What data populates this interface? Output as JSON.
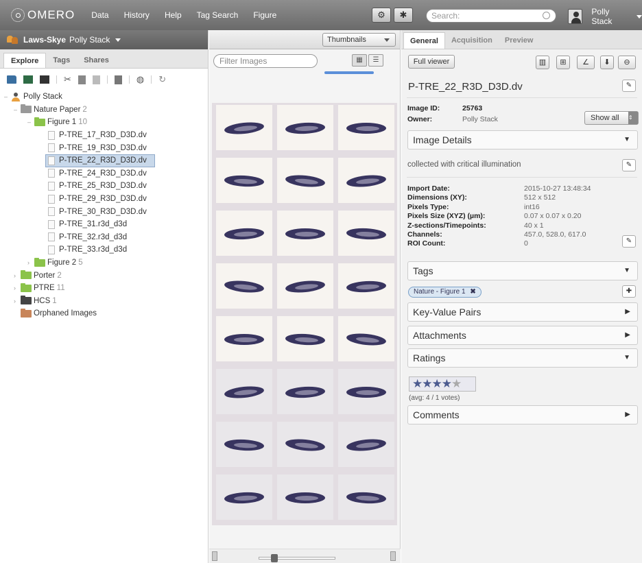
{
  "topbar": {
    "logo": "OMERO",
    "nav": [
      "Data",
      "History",
      "Help",
      "Tag Search",
      "Figure"
    ],
    "search_placeholder": "Search:",
    "user": "Polly Stack"
  },
  "left": {
    "group": {
      "name": "Laws-Skye",
      "owner": "Polly Stack"
    },
    "tabs": [
      "Explore",
      "Tags",
      "Shares"
    ],
    "tree": {
      "root": "Polly Stack",
      "project": {
        "name": "Nature Paper",
        "count": "2"
      },
      "dataset_open": {
        "name": "Figure 1",
        "count": "10"
      },
      "images": [
        "P-TRE_17_R3D_D3D.dv",
        "P-TRE_19_R3D_D3D.dv",
        "P-TRE_22_R3D_D3D.dv",
        "P-TRE_24_R3D_D3D.dv",
        "P-TRE_25_R3D_D3D.dv",
        "P-TRE_29_R3D_D3D.dv",
        "P-TRE_30_R3D_D3D.dv",
        "P-TRE_31.r3d_d3d",
        "P-TRE_32.r3d_d3d",
        "P-TRE_33.r3d_d3d"
      ],
      "dataset_closed": {
        "name": "Figure 2",
        "count": "5"
      },
      "others": [
        {
          "name": "Porter",
          "count": "2"
        },
        {
          "name": "PTRE",
          "count": "11"
        },
        {
          "name": "HCS",
          "count": "1"
        }
      ],
      "orphaned": "Orphaned Images"
    }
  },
  "center": {
    "view_select": "Thumbnails",
    "filter_placeholder": "Filter Images"
  },
  "right": {
    "tabs": [
      "General",
      "Acquisition",
      "Preview"
    ],
    "full_viewer": "Full viewer",
    "image_name": "P-TRE_22_R3D_D3D.dv",
    "image_id_label": "Image ID:",
    "image_id": "25763",
    "owner_label": "Owner:",
    "owner": "Polly Stack",
    "show_all": "Show all",
    "image_details": "Image Details",
    "description": "collected with critical illumination",
    "details": [
      {
        "label": "Import Date:",
        "value": "2015-10-27 13:48:34"
      },
      {
        "label": "Dimensions (XY):",
        "value": "512 x 512"
      },
      {
        "label": "Pixels Type:",
        "value": "int16"
      },
      {
        "label": "Pixels Size (XYZ) (µm):",
        "value": "0.07 x 0.07 x 0.20"
      },
      {
        "label": "Z-sections/Timepoints:",
        "value": "40 x 1"
      },
      {
        "label": "Channels:",
        "value": "457.0, 528.0, 617.0"
      },
      {
        "label": "ROI Count:",
        "value": "0"
      }
    ],
    "tags_title": "Tags",
    "tag": "Nature - Figure 1",
    "kv_title": "Key-Value Pairs",
    "attachments_title": "Attachments",
    "ratings_title": "Ratings",
    "rating": {
      "avg": 4,
      "max": 5,
      "label": "(avg: 4 / 1 votes)"
    },
    "comments_title": "Comments"
  },
  "colors": {
    "topbar": "#7a7a7a",
    "selected_row": "#c8d8ea",
    "embryo": "#38345f",
    "tag_pill": "#dbe7f3"
  }
}
